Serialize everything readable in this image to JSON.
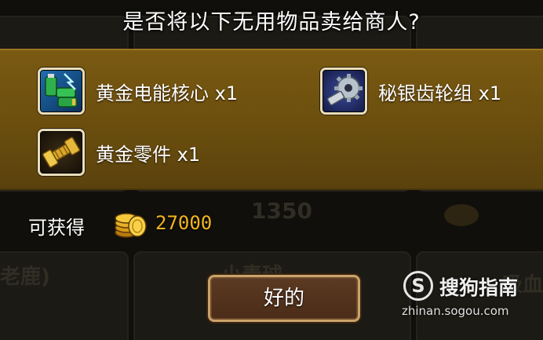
{
  "dialog": {
    "title": "是否将以下无用物品卖给商人?",
    "items": [
      {
        "name": "黄金电能核心 x1",
        "icon": "battery-icon"
      },
      {
        "name": "秘银齿轮组 x1",
        "icon": "gear-icon"
      },
      {
        "name": "黄金零件 x1",
        "icon": "bolt-icon"
      }
    ],
    "reward_label": "可获得",
    "reward_icon": "gold-coin-icon",
    "reward_value": "27000",
    "ok_label": "好的"
  },
  "background": {
    "ghost_value": "1350",
    "ghost_text_left": "老鹿)",
    "ghost_text_center": "小毒球",
    "ghost_text_right": "吸血"
  },
  "watermark": {
    "brand": "搜狗指南",
    "domain": "zhinan.sogou.com"
  },
  "colors": {
    "panel": "#6b4e0e",
    "reward_value": "#f2b51e",
    "button_border": "#c9a36a"
  }
}
